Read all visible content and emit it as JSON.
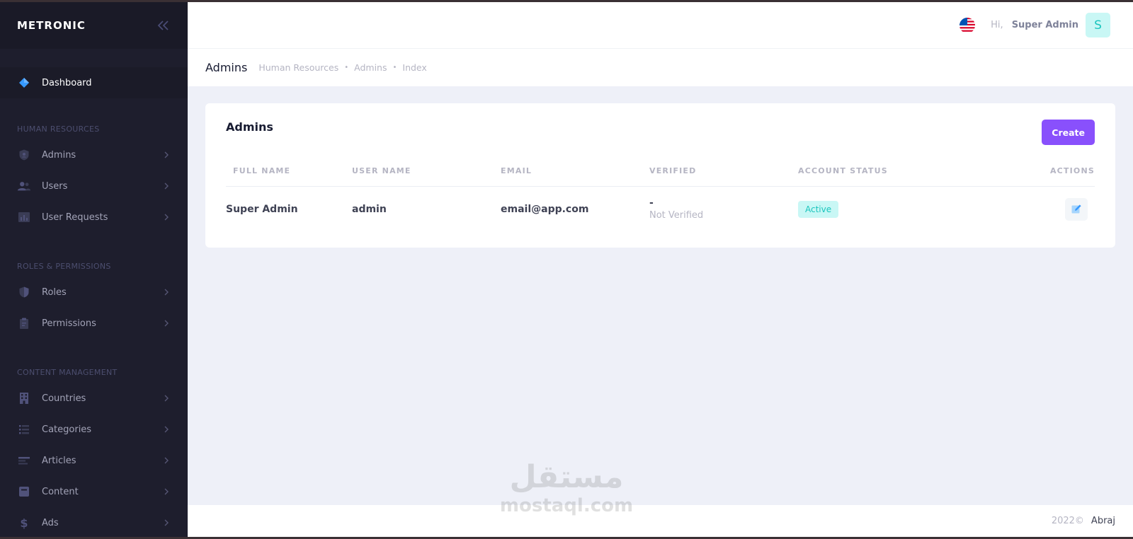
{
  "sidebar": {
    "brand": "METRONIC",
    "dashboard_label": "Dashboard",
    "sections": [
      {
        "title": "HUMAN RESOURCES",
        "items": [
          {
            "label": "Admins",
            "icon": "shield-icon"
          },
          {
            "label": "Users",
            "icon": "users-icon"
          },
          {
            "label": "User Requests",
            "icon": "chart-icon"
          }
        ]
      },
      {
        "title": "ROLES & PERMISSIONS",
        "items": [
          {
            "label": "Roles",
            "icon": "shield-icon"
          },
          {
            "label": "Permissions",
            "icon": "clipboard-icon"
          }
        ]
      },
      {
        "title": "CONTENT MANAGEMENT",
        "items": [
          {
            "label": "Countries",
            "icon": "building-icon"
          },
          {
            "label": "Categories",
            "icon": "list-icon"
          },
          {
            "label": "Articles",
            "icon": "article-icon"
          },
          {
            "label": "Content",
            "icon": "content-icon"
          },
          {
            "label": "Ads",
            "icon": "dollar-icon"
          }
        ]
      }
    ]
  },
  "topbar": {
    "greeting": "Hi,",
    "user_name": "Super Admin",
    "avatar_letter": "S"
  },
  "subheader": {
    "title": "Admins",
    "breadcrumb": [
      "Human Resources",
      "Admins",
      "Index"
    ]
  },
  "card": {
    "title": "Admins",
    "create_label": "Create",
    "columns": [
      "FULL NAME",
      "USER NAME",
      "EMAIL",
      "VERIFIED",
      "ACCOUNT STATUS",
      "ACTIONS"
    ],
    "rows": [
      {
        "full_name": "Super Admin",
        "user_name": "admin",
        "email": "email@app.com",
        "verified_dash": "-",
        "verified_text": "Not Verified",
        "status": "Active"
      }
    ]
  },
  "footer": {
    "year": "2022©",
    "company": "Abraj"
  },
  "watermark": {
    "arabic": "مستقل",
    "latin": "mostaql.com"
  },
  "colors": {
    "sidebar_bg": "#1e1e2d",
    "accent_purple": "#8950fc",
    "active_badge_bg": "#c9f7f5",
    "active_badge_text": "#1bc5bd",
    "dashboard_icon": "#3699ff"
  }
}
